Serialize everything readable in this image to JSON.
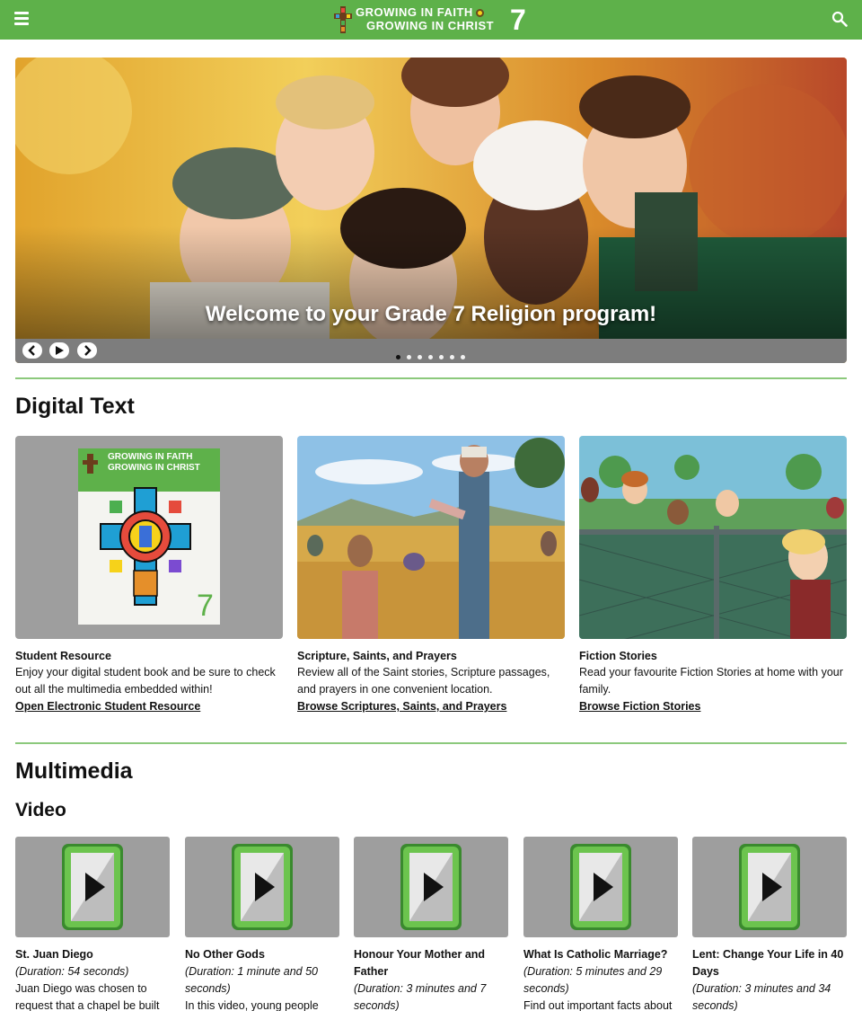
{
  "header": {
    "logo_line1": "GROWING IN FAITH",
    "logo_line2": "GROWING IN CHRIST",
    "logo_grade": "7",
    "accent_color": "#5eb14a",
    "menu_icon": "hamburger-menu-icon",
    "search_icon": "search-icon"
  },
  "hero": {
    "caption": "Welcome to your Grade 7 Religion program!",
    "slide_count": 7,
    "active_slide": 1,
    "controls": [
      "previous",
      "play",
      "next"
    ]
  },
  "digital_text": {
    "heading": "Digital Text",
    "cards": [
      {
        "title": "Student Resource",
        "description": "Enjoy your digital student book and be sure to check out all the multimedia embedded within!",
        "link": "Open Electronic Student Resource",
        "cover_line1": "GROWING IN FAITH",
        "cover_line2": "GROWING IN CHRIST",
        "cover_grade": "7"
      },
      {
        "title": "Scripture, Saints, and Prayers",
        "description": "Review all of the Saint stories, Scripture passages, and prayers in one convenient location.",
        "link": "Browse Scriptures, Saints, and Prayers"
      },
      {
        "title": "Fiction Stories",
        "description": "Read your favourite Fiction Stories at home with your family.",
        "link": "Browse Fiction Stories"
      }
    ]
  },
  "multimedia": {
    "heading": "Multimedia",
    "video_heading": "Video",
    "videos": [
      {
        "title": "St. Juan Diego",
        "duration": "(Duration: 54 seconds)",
        "description": "Juan Diego was chosen to request that a chapel be built"
      },
      {
        "title": "No Other Gods",
        "duration": "(Duration: 1 minute and 50 seconds)",
        "description": "In this video, young people"
      },
      {
        "title": "Honour Your Mother and Father",
        "duration": "(Duration: 3 minutes and 7 seconds)",
        "description": ""
      },
      {
        "title": "What Is Catholic Marriage?",
        "duration": "(Duration: 5 minutes and 29 seconds)",
        "description": "Find out important facts about"
      },
      {
        "title": "Lent: Change Your Life in 40 Days",
        "duration": "(Duration: 3 minutes and 34 seconds)",
        "description": ""
      }
    ]
  }
}
